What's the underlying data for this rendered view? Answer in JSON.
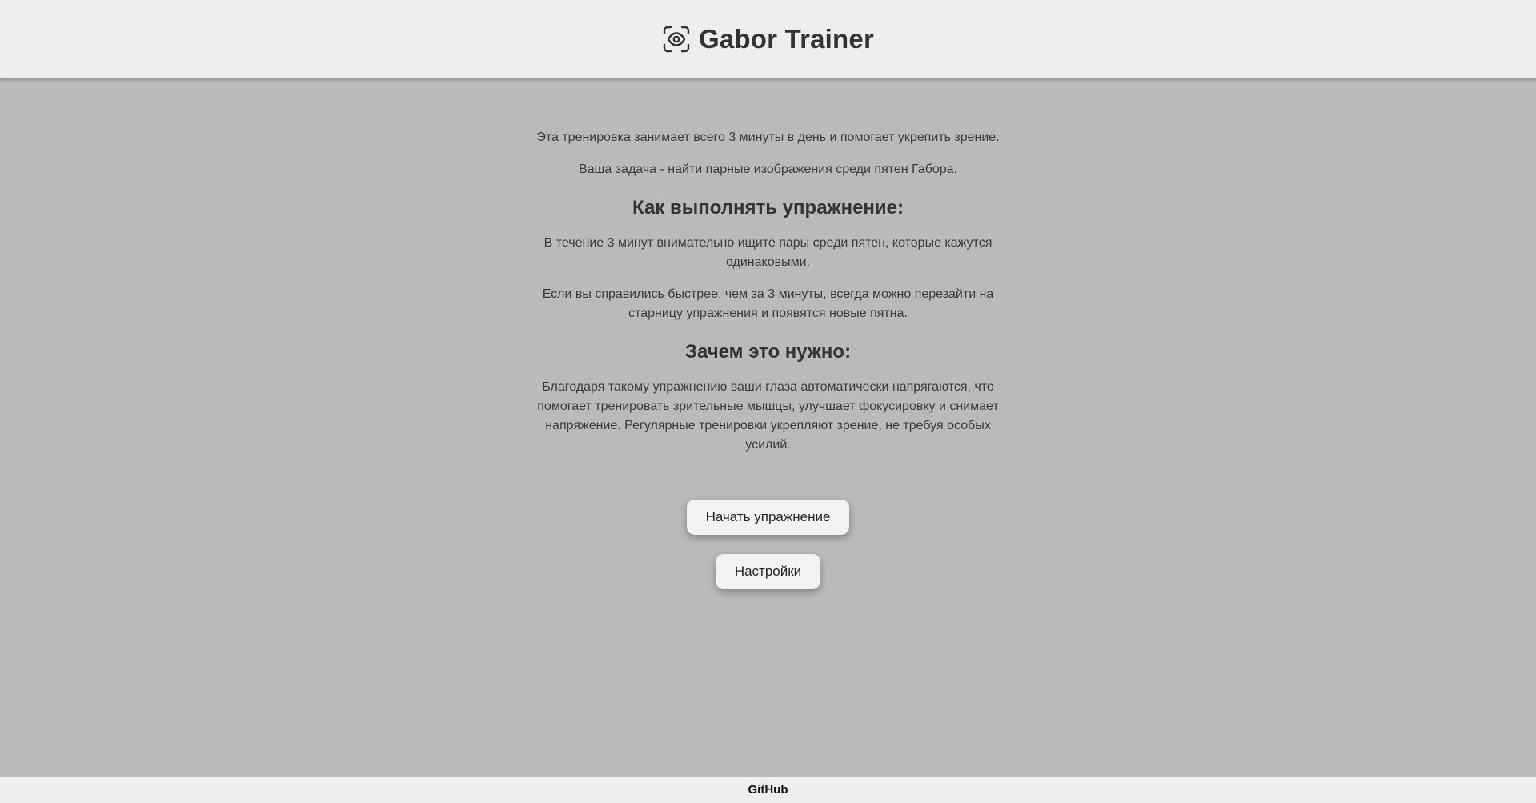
{
  "header": {
    "title": "Gabor Trainer",
    "logo_icon": "eye-scan-icon"
  },
  "main": {
    "intro": [
      "Эта тренировка занимает всего 3 минуты в день и помогает укрепить зрение.",
      "Ваша задача - найти парные изображения среди пятен Габора."
    ],
    "how_heading": "Как выполнять упражнение:",
    "how_paragraphs": [
      "В течение 3 минут внимательно ищите пары среди пятен, которые кажутся одинаковыми.",
      "Если вы справились быстрее, чем за 3 минуты, всегда можно перезайти на старницу упражнения и появятся новые пятна."
    ],
    "why_heading": "Зачем это нужно:",
    "why_paragraph": "Благодаря такому упражнению ваши глаза автоматически напрягаются, что помогает тренировать зрительные мышцы, улучшает фокусировку и снимает напряжение. Регулярные тренировки укрепляют зрение, не требуя особых усилий.",
    "start_button": "Начать упражнение",
    "settings_button": "Настройки"
  },
  "footer": {
    "link": "GitHub"
  },
  "colors": {
    "header_bg": "#eeeeee",
    "page_bg": "#bababa",
    "button_bg": "#f2f2f2",
    "text": "#333333"
  }
}
